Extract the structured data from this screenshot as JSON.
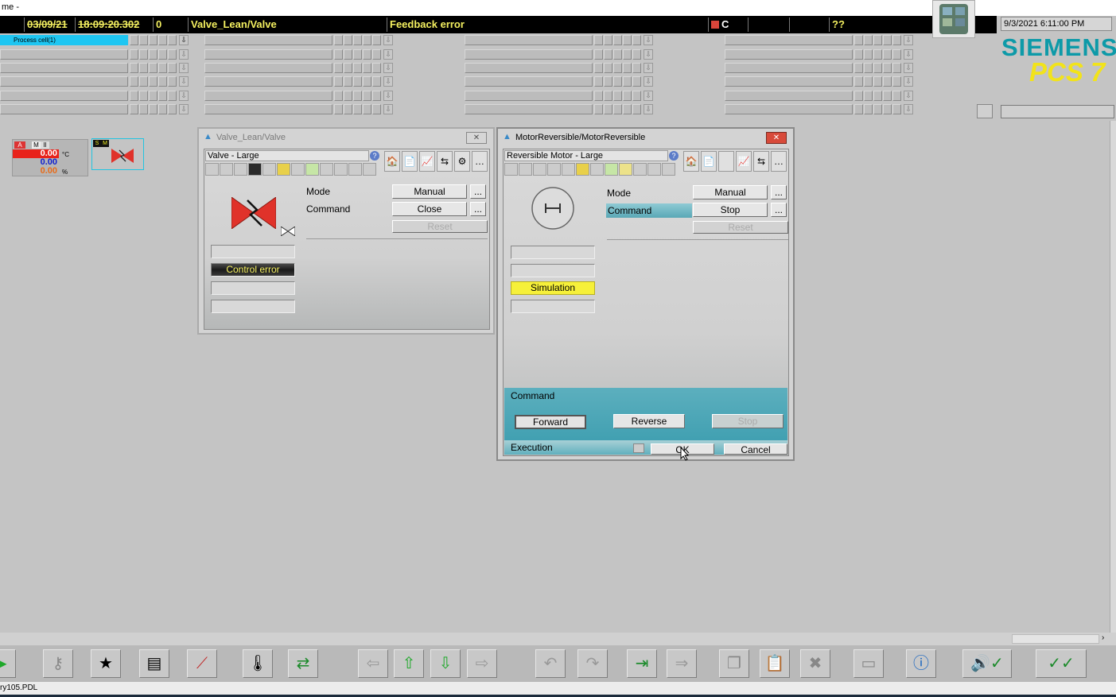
{
  "window": {
    "title_fragment": "me -"
  },
  "alarm_line": {
    "date": "03/09/21",
    "time": "18:09:20.302",
    "number": "0",
    "source": "Valve_Lean/Valve",
    "event": "Feedback error",
    "class": "C",
    "priority": "??"
  },
  "overview": {
    "process_cell_label": "Process cell(1)"
  },
  "header_right": {
    "datetime": "9/3/2021 6:11:00 PM",
    "logo_text": "SIEMENS",
    "product_text": "PCS 7"
  },
  "block_icons": {
    "analog": {
      "tags": [
        "A",
        "M",
        "II"
      ],
      "values": [
        "0.00",
        "0.00",
        "0.00"
      ],
      "units": [
        "°C",
        "",
        "%"
      ]
    },
    "valve": {
      "tags": [
        "S",
        "M"
      ]
    }
  },
  "valve_faceplate": {
    "title": "Valve_Lean/Valve",
    "view_name": "Valve - Large",
    "mode_label": "Mode",
    "mode_value": "Manual",
    "command_label": "Command",
    "command_value": "Close",
    "reset_label": "Reset",
    "dots": "...",
    "status_messages": [
      "",
      "Control error",
      "",
      ""
    ],
    "close_symbol": "✕"
  },
  "motor_faceplate": {
    "title": "MotorReversible/MotorReversible",
    "view_name": "Reversible Motor - Large",
    "mode_label": "Mode",
    "mode_value": "Manual",
    "command_label": "Command",
    "command_value": "Stop",
    "reset_label": "Reset",
    "dots": "...",
    "status_messages": [
      "",
      "",
      "Simulation",
      ""
    ],
    "command_panel": {
      "title": "Command",
      "forward": "Forward",
      "reverse": "Reverse",
      "stop": "Stop",
      "execution_label": "Execution",
      "ok": "OK",
      "cancel": "Cancel"
    },
    "close_symbol": "✕"
  },
  "status_bar": {
    "file": "ry105.PDL"
  },
  "colors": {
    "alarm_text": "#f4f060",
    "process_cell": "#1ec6f2",
    "siemens_teal": "#0d9aa8",
    "pcs7_yellow": "#f2e31a",
    "valve_red": "#e0322a",
    "simulation": "#f6f03a",
    "command_teal": "#4aa6b6"
  }
}
